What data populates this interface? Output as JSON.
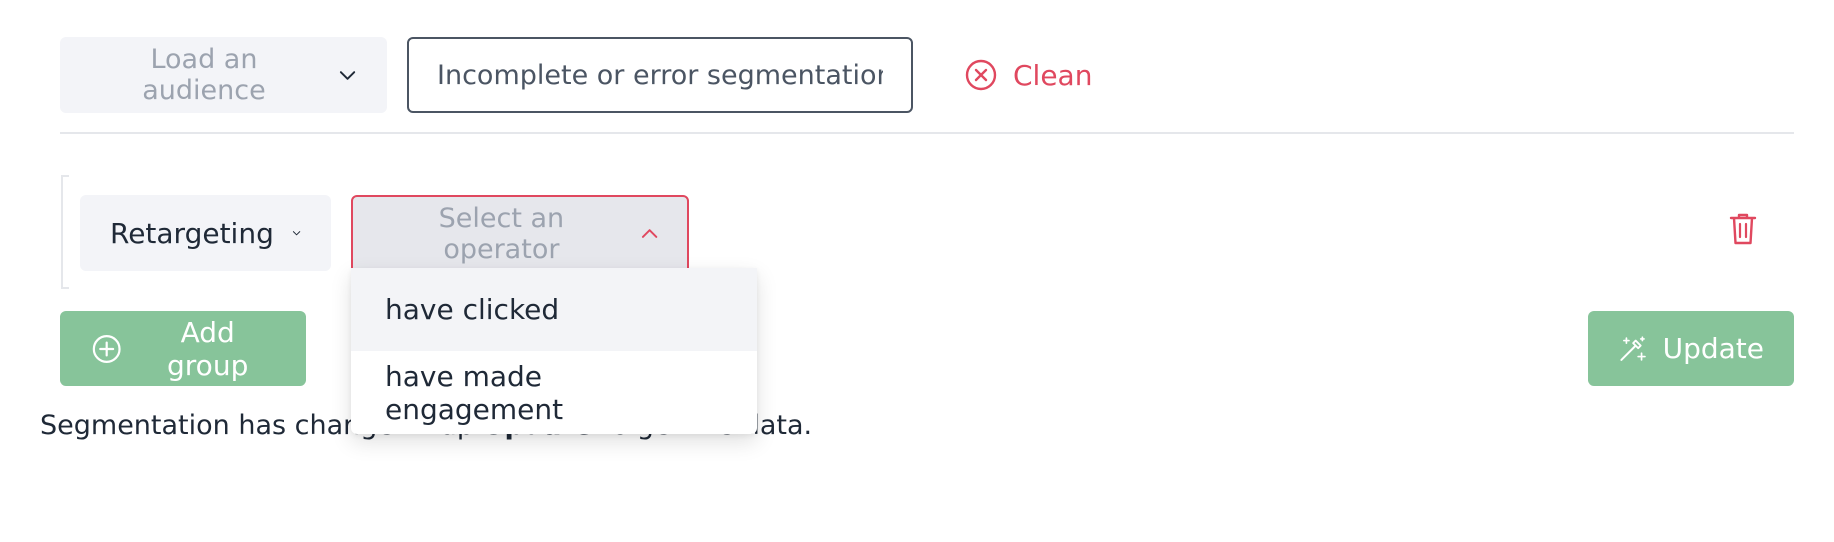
{
  "toolbar": {
    "audience_label": "Load an audience",
    "segmentation_placeholder": "Incomplete or error segmentation.",
    "clean_label": "Clean"
  },
  "group": {
    "criterion_label": "Retargeting",
    "operator_placeholder": "Select an operator",
    "operator_options": [
      {
        "label": "have clicked",
        "highlighted": true
      },
      {
        "label": "have made engagement",
        "highlighted": false
      }
    ]
  },
  "actions": {
    "add_group_label": "Add group",
    "update_label": "Update"
  },
  "status": {
    "prefix": "Segmentation has changed. Tap ",
    "bold": "Update",
    "suffix": " to get the data."
  },
  "colors": {
    "accent_red": "#e0485f",
    "button_green": "#87c49a",
    "field_bg": "#f3f4f8"
  },
  "icons": {
    "audience_chevron": "chevron-down-icon",
    "clean": "close-circle-icon",
    "criterion_chevron": "chevron-down-icon",
    "operator_chevron": "chevron-up-icon",
    "delete": "trash-icon",
    "add_group": "plus-circle-icon",
    "update": "magic-wand-icon"
  }
}
